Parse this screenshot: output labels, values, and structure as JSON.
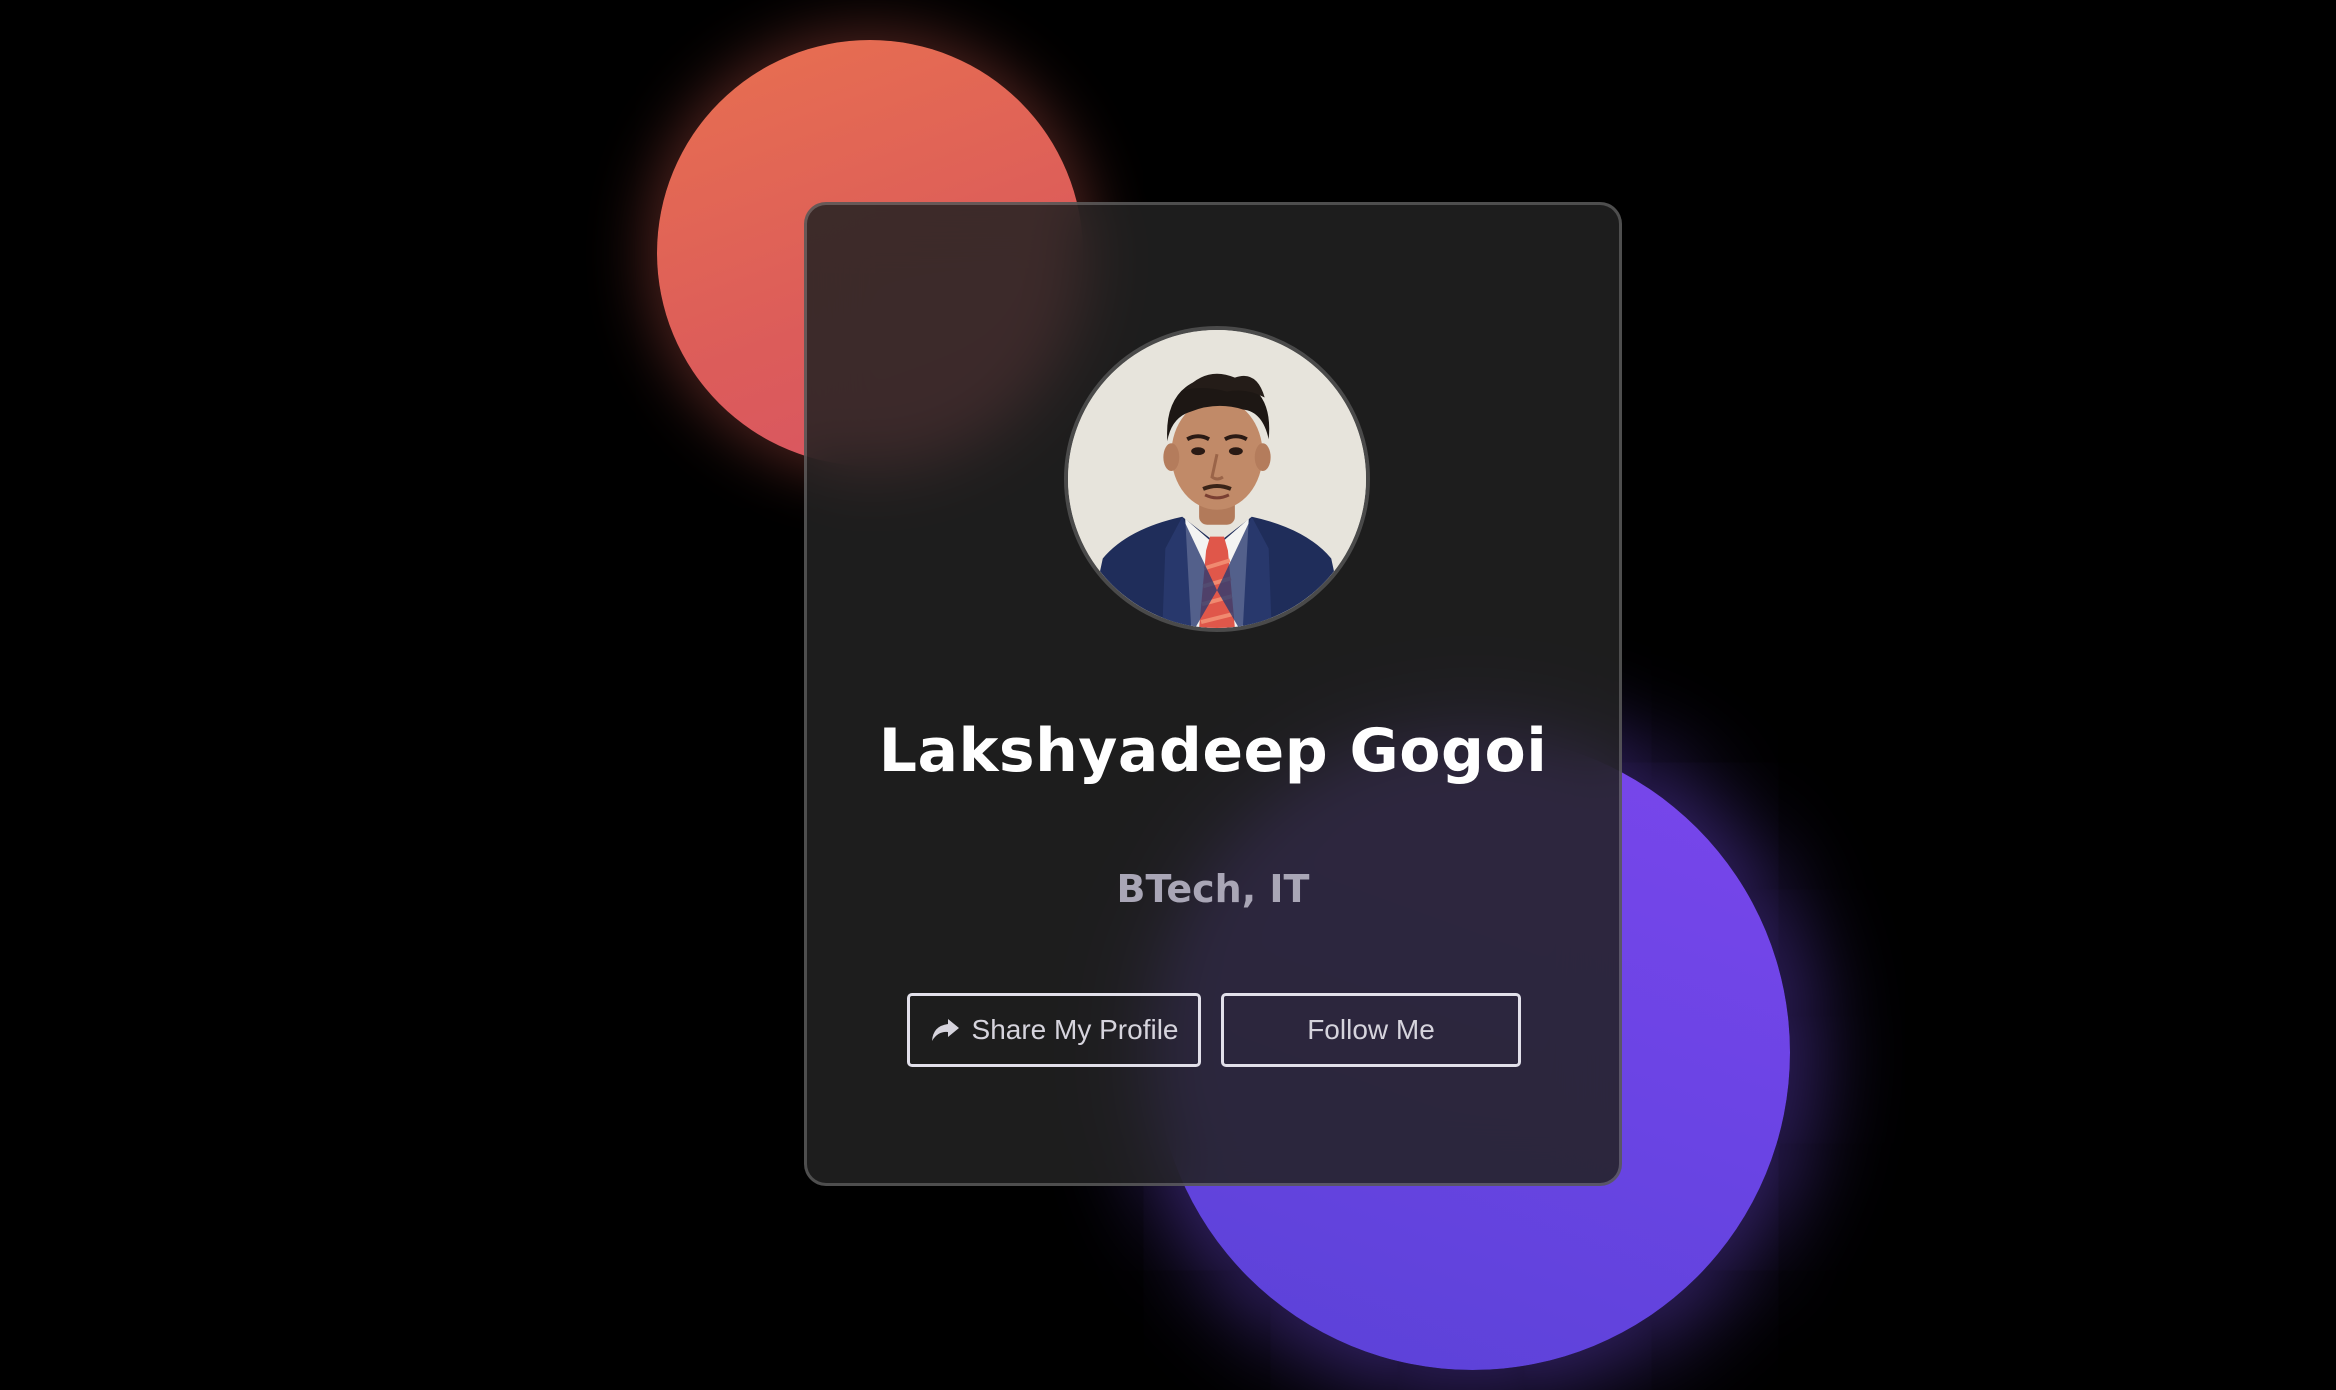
{
  "profile": {
    "name": "Lakshyadeep Gogoi",
    "subtitle": "BTech, IT"
  },
  "buttons": {
    "share_label": "Share My Profile",
    "share_icon": "share-arrow-icon",
    "follow_label": "Follow Me"
  },
  "theme": {
    "background": "#000000",
    "card_background": "#1c1c1c",
    "blob_coral": "#e2665a",
    "blob_violet": "#6d46e6",
    "text_primary": "#ffffff",
    "text_secondary": "#a9a6b6"
  }
}
